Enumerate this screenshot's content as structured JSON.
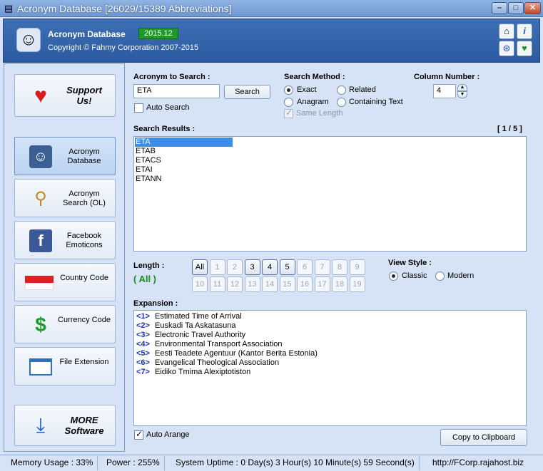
{
  "window": {
    "title": "Acronym Database [26029/15389 Abbreviations]"
  },
  "header": {
    "app_name": "Acronym Database",
    "version": "2015.12",
    "copyright": "Copyright © Fahmy Corporation 2007-2015"
  },
  "sidebar": {
    "support_label": "Support Us!",
    "items": [
      {
        "label": "Acronym Database",
        "icon": "mac-face-icon"
      },
      {
        "label": "Acronym Search (OL)",
        "icon": "magnifier-icon"
      },
      {
        "label": "Facebook Emoticons",
        "icon": "facebook-icon"
      },
      {
        "label": "Country Code",
        "icon": "flag-icon"
      },
      {
        "label": "Currency Code",
        "icon": "dollar-icon"
      },
      {
        "label": "File Extension",
        "icon": "window-icon"
      }
    ],
    "more_label": "MORE Software"
  },
  "search": {
    "label": "Acronym to Search :",
    "value": "ETA",
    "button": "Search",
    "auto_search_label": "Auto Search",
    "auto_search_checked": false
  },
  "method": {
    "label": "Search Method :",
    "options": [
      "Exact",
      "Related",
      "Anagram",
      "Containing Text"
    ],
    "selected": "Exact",
    "same_length_label": "Same Length",
    "same_length_checked": true
  },
  "column": {
    "label": "Column Number :",
    "value": "4"
  },
  "results": {
    "label": "Search Results :",
    "page": "[ 1 / 5 ]",
    "items": [
      "ETA",
      "ETAB",
      "ETACS",
      "ETAI",
      "ETANN"
    ],
    "selected_index": 0
  },
  "length": {
    "label": "Length :",
    "current": "( All )",
    "row1": [
      "All",
      "1",
      "2",
      "3",
      "4",
      "5",
      "6",
      "7",
      "8",
      "9"
    ],
    "row2": [
      "10",
      "11",
      "12",
      "13",
      "14",
      "15",
      "16",
      "17",
      "18",
      "19"
    ],
    "enabled": [
      "All",
      "3",
      "4",
      "5"
    ]
  },
  "view": {
    "label": "View Style :",
    "options": [
      "Classic",
      "Modern"
    ],
    "selected": "Classic"
  },
  "expansion": {
    "label": "Expansion :",
    "items": [
      {
        "num": "<1>",
        "text": "Estimated Time of Arrival"
      },
      {
        "num": "<2>",
        "text": "Euskadi Ta Askatasuna"
      },
      {
        "num": "<3>",
        "text": "Electronic Travel Authority"
      },
      {
        "num": "<4>",
        "text": "Environmental Transport Association"
      },
      {
        "num": "<5>",
        "text": "Eesti Teadete Agentuur (Kantor Berita Estonia)"
      },
      {
        "num": "<6>",
        "text": "Evangelical Theological Association"
      },
      {
        "num": "<7>",
        "text": "Eidiko Tmima Alexiptotiston"
      }
    ]
  },
  "footer": {
    "auto_arrange_label": "Auto Arange",
    "auto_arrange_checked": true,
    "copy_button": "Copy to Clipboard"
  },
  "status": {
    "memory": "Memory Usage : 33%",
    "power": "Power : 255%",
    "uptime": "System Uptime : 0 Day(s) 3 Hour(s) 10 Minute(s) 59 Second(s)",
    "url": "http://FCorp.rajahost.biz"
  },
  "colors": {
    "accent": "#2b5aa0",
    "version_badge": "#1e9a2a",
    "length_all": "#1c8a1c",
    "expansion_num": "#1a35b8",
    "selection": "#3d8ee8"
  }
}
